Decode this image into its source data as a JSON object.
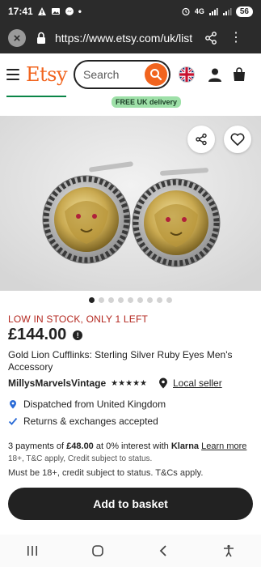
{
  "status_bar": {
    "time": "17:41",
    "network": "4G",
    "battery": "56"
  },
  "browser": {
    "url": "https://www.etsy.com/uk/list"
  },
  "header": {
    "logo": "Etsy",
    "search_placeholder": "Search"
  },
  "badge": {
    "delivery": "FREE UK delivery"
  },
  "gallery": {
    "dot_count": 9,
    "active_index": 0
  },
  "product": {
    "stock": "LOW IN STOCK, ONLY 1 LEFT",
    "price": "£144.00",
    "title": "Gold Lion Cufflinks: Sterling Silver Ruby Eyes Men's Accessory",
    "shop": "MillysMarvelsVintage",
    "stars": "★★★★★",
    "local_seller": "Local seller",
    "dispatched": "Dispatched from United Kingdom",
    "returns": "Returns & exchanges accepted"
  },
  "klarna": {
    "prefix": "3 payments of ",
    "amount": "£48.00",
    "middle": " at 0% interest with ",
    "brand": "Klarna",
    "learn_more": "Learn more",
    "note_small": "18+, T&C apply, Credit subject to status.",
    "note": "Must be 18+, credit subject to status. T&Cs apply."
  },
  "actions": {
    "add_to_basket": "Add to basket"
  },
  "colors": {
    "brand": "#f1641e",
    "stock_red": "#b3261e",
    "badge_green": "#9ee0a8",
    "dark": "#222222"
  }
}
